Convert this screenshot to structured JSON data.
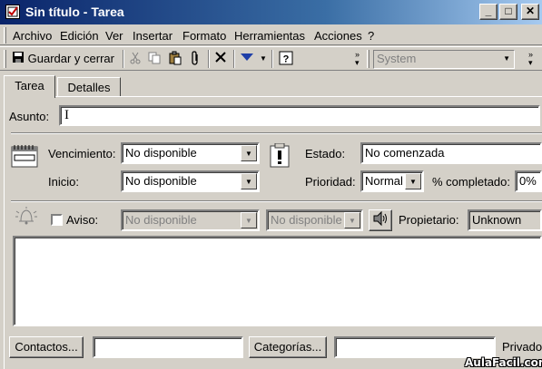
{
  "window": {
    "title": "Sin título - Tarea",
    "controls": {
      "minimize": "_",
      "maximize": "□",
      "close": "✕"
    }
  },
  "menubar": {
    "items": [
      "Archivo",
      "Edición",
      "Ver",
      "Insertar",
      "Formato",
      "Herramientas",
      "Acciones",
      "?"
    ]
  },
  "toolbar": {
    "save_close_label": "Guardar y cerrar",
    "font_combo_value": "System"
  },
  "tabs": [
    "Tarea",
    "Detalles"
  ],
  "form": {
    "subject_label": "Asunto:",
    "subject_value": "",
    "due_label": "Vencimiento:",
    "due_value": "No disponible",
    "start_label": "Inicio:",
    "start_value": "No disponible",
    "status_label": "Estado:",
    "status_value": "No comenzada",
    "priority_label": "Prioridad:",
    "priority_value": "Normal",
    "percent_label": "% completado:",
    "percent_value": "0%",
    "reminder_label": "Aviso:",
    "reminder_date": "No disponible",
    "reminder_time": "No disponible",
    "owner_label": "Propietario:",
    "owner_value": "Unknown",
    "contacts_button": "Contactos...",
    "categories_button": "Categorías...",
    "private_label": "Privado"
  },
  "watermark": "AulaFacil.com",
  "icons": {
    "app": "task-checkmark-icon",
    "save": "floppy-disk-icon",
    "cut": "scissors-icon",
    "copy": "copy-icon",
    "paste": "paste-icon",
    "attach": "paperclip-icon",
    "delete": "x-delete-icon",
    "move": "arrow-down-icon",
    "help": "help-icon",
    "calendar": "calendar-icon",
    "importance": "exclamation-icon",
    "reminder": "bell-icon",
    "sound": "speaker-icon"
  },
  "colors": {
    "titlebar_start": "#0a246a",
    "titlebar_end": "#a6caf0",
    "face": "#d4d0c8"
  }
}
